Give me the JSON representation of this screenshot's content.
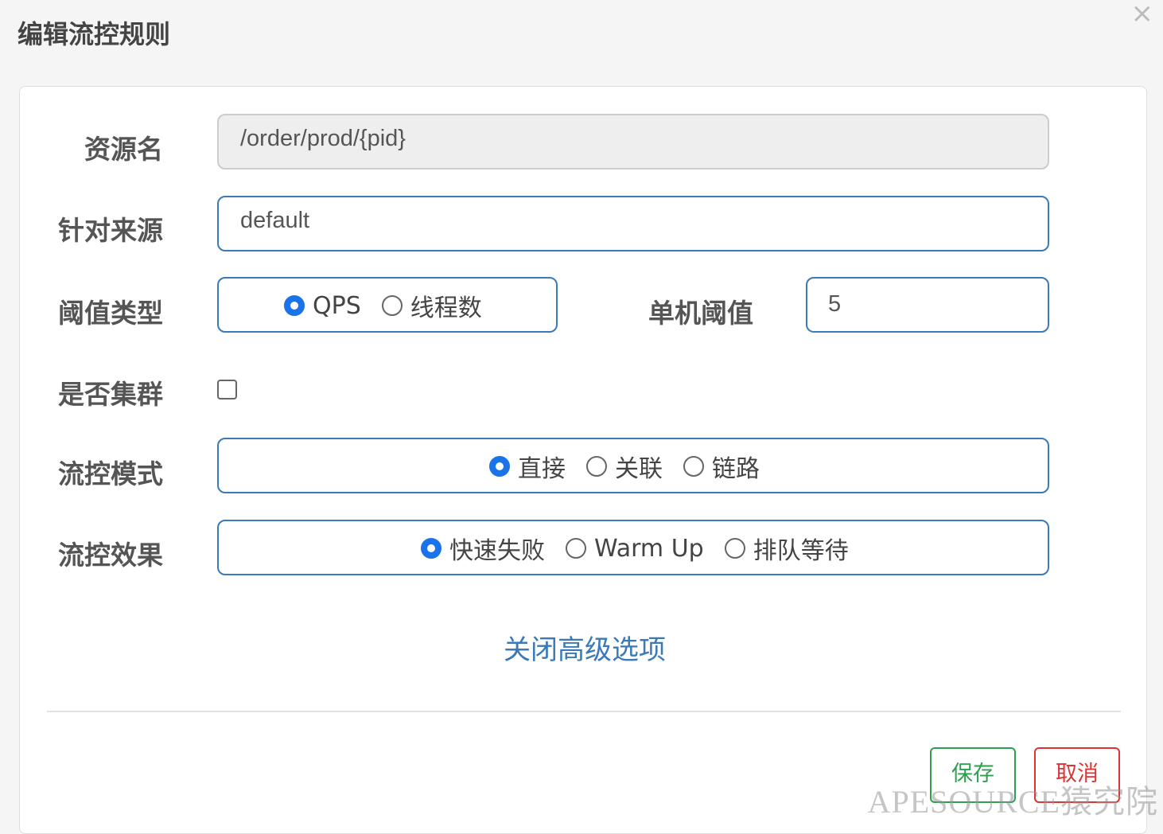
{
  "dialog": {
    "title": "编辑流控规则",
    "close_symbol": "×"
  },
  "form": {
    "resource": {
      "label": "资源名",
      "value": "/order/prod/{pid}"
    },
    "origin": {
      "label": "针对来源",
      "value": "default"
    },
    "threshold_type": {
      "label": "阈值类型",
      "options": [
        {
          "label": "QPS",
          "checked": true
        },
        {
          "label": "线程数",
          "checked": false
        }
      ]
    },
    "threshold": {
      "label": "单机阈值",
      "value": "5"
    },
    "cluster": {
      "label": "是否集群",
      "checked": false
    },
    "mode": {
      "label": "流控模式",
      "options": [
        {
          "label": "直接",
          "checked": true
        },
        {
          "label": "关联",
          "checked": false
        },
        {
          "label": "链路",
          "checked": false
        }
      ]
    },
    "effect": {
      "label": "流控效果",
      "options": [
        {
          "label": "快速失败",
          "checked": true
        },
        {
          "label": "Warm Up",
          "checked": false
        },
        {
          "label": "排队等待",
          "checked": false
        }
      ]
    },
    "advanced_toggle": "关闭高级选项"
  },
  "buttons": {
    "save": "保存",
    "cancel": "取消"
  },
  "watermark": "APESOURCE猿究院",
  "colors": {
    "primary": "#3a7ab8",
    "radio_checked": "#1a73e8",
    "save": "#2e9e4f",
    "cancel": "#dd3333"
  }
}
